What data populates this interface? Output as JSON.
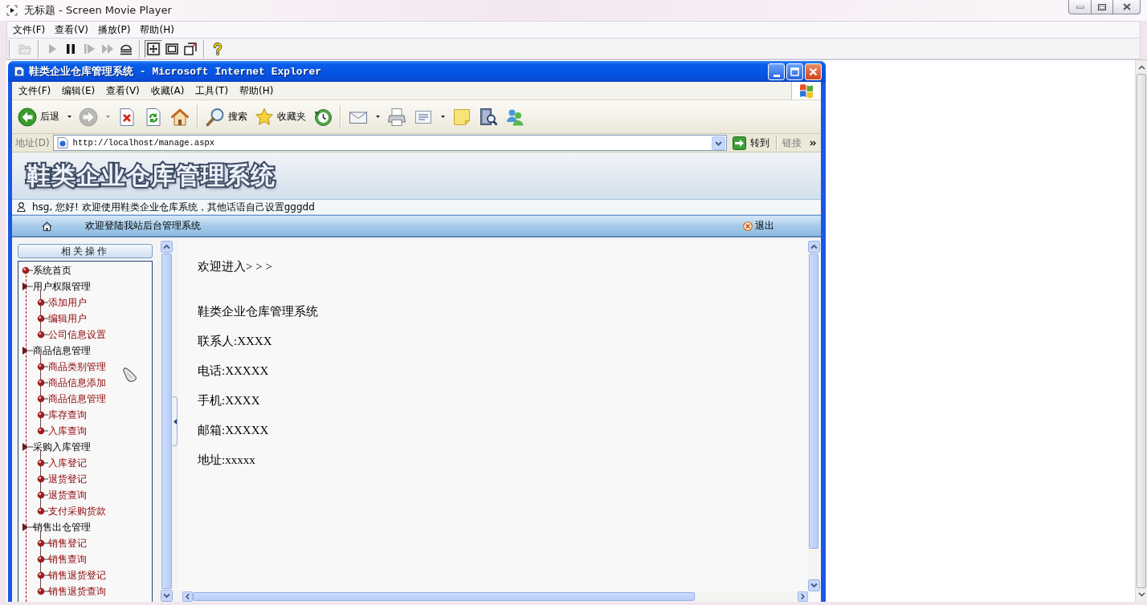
{
  "player": {
    "title": "无标题 - Screen Movie Player",
    "menu": [
      "文件(F)",
      "查看(V)",
      "播放(P)",
      "帮助(H)"
    ],
    "toolbar": [
      {
        "buttons": [
          {
            "kind": "open",
            "disabled": true
          }
        ]
      },
      {
        "buttons": [
          {
            "kind": "play",
            "disabled": true
          },
          {
            "kind": "pause",
            "disabled": false
          },
          {
            "kind": "step",
            "disabled": true
          },
          {
            "kind": "fast-forward",
            "disabled": true
          },
          {
            "kind": "eject",
            "disabled": false
          }
        ]
      },
      {
        "buttons": [
          {
            "kind": "fit",
            "selected": true
          },
          {
            "kind": "window",
            "selected": false
          },
          {
            "kind": "resize",
            "selected": false
          }
        ]
      },
      {
        "buttons": [
          {
            "kind": "help",
            "disabled": false
          }
        ]
      }
    ]
  },
  "browser": {
    "title": "鞋类企业仓库管理系统 - Microsoft Internet Explorer",
    "menu": [
      "文件(F)",
      "编辑(E)",
      "查看(V)",
      "收藏(A)",
      "工具(T)",
      "帮助(H)"
    ],
    "toolbar": [
      {
        "buttons": [
          {
            "kind": "back",
            "label": "后退",
            "disabled": false
          },
          {
            "kind": "forward",
            "disabled": true
          },
          {
            "kind": "stop",
            "disabled": false
          },
          {
            "kind": "refresh",
            "disabled": false
          },
          {
            "kind": "home",
            "disabled": false
          }
        ]
      },
      {
        "buttons": [
          {
            "kind": "search",
            "label": "搜索",
            "disabled": false
          },
          {
            "kind": "favorites",
            "label": "收藏夹",
            "disabled": false
          },
          {
            "kind": "history",
            "disabled": false
          }
        ]
      },
      {
        "buttons": [
          {
            "kind": "mail",
            "disabled": false
          },
          {
            "kind": "print",
            "disabled": false
          },
          {
            "kind": "edit",
            "disabled": false
          },
          {
            "kind": "note",
            "disabled": false
          },
          {
            "kind": "research",
            "disabled": false
          },
          {
            "kind": "messenger",
            "disabled": false
          }
        ]
      }
    ],
    "address": {
      "label": "地址(D)",
      "value": "http://localhost/manage.aspx",
      "go": "转到",
      "links": "链接"
    }
  },
  "page": {
    "banner": "鞋类企业仓库管理系统",
    "greeting": "hsg, 您好! 欢迎使用鞋类企业仓库系统，其他话语自己设置gggdd",
    "nav_text": "欢迎登陆我站后台管理系统",
    "logout": "退出",
    "sidebar": {
      "header": "相关操作",
      "tree": [
        {
          "label": "系统首页"
        },
        {
          "label": "用户权限管理",
          "children": [
            {
              "label": "添加用户"
            },
            {
              "label": "编辑用户"
            },
            {
              "label": "公司信息设置"
            }
          ]
        },
        {
          "label": "商品信息管理",
          "children": [
            {
              "label": "商品类别管理"
            },
            {
              "label": "商品信息添加"
            },
            {
              "label": "商品信息管理"
            },
            {
              "label": "库存查询"
            },
            {
              "label": "入库查询"
            }
          ]
        },
        {
          "label": "采购入库管理",
          "children": [
            {
              "label": "入库登记"
            },
            {
              "label": "退货登记"
            },
            {
              "label": "退货查询"
            },
            {
              "label": "支付采购货款"
            }
          ]
        },
        {
          "label": "销售出仓管理",
          "children": [
            {
              "label": "销售登记"
            },
            {
              "label": "销售查询"
            },
            {
              "label": "销售退货登记"
            },
            {
              "label": "销售退货查询"
            }
          ]
        }
      ]
    },
    "content": {
      "heading": "欢迎进入> > >",
      "lines": [
        "鞋类企业仓库管理系统",
        "联系人:XXXX",
        "电话:XXXXX",
        "手机:XXXX",
        "邮箱:XXXXX",
        "地址:xxxxx"
      ]
    }
  }
}
